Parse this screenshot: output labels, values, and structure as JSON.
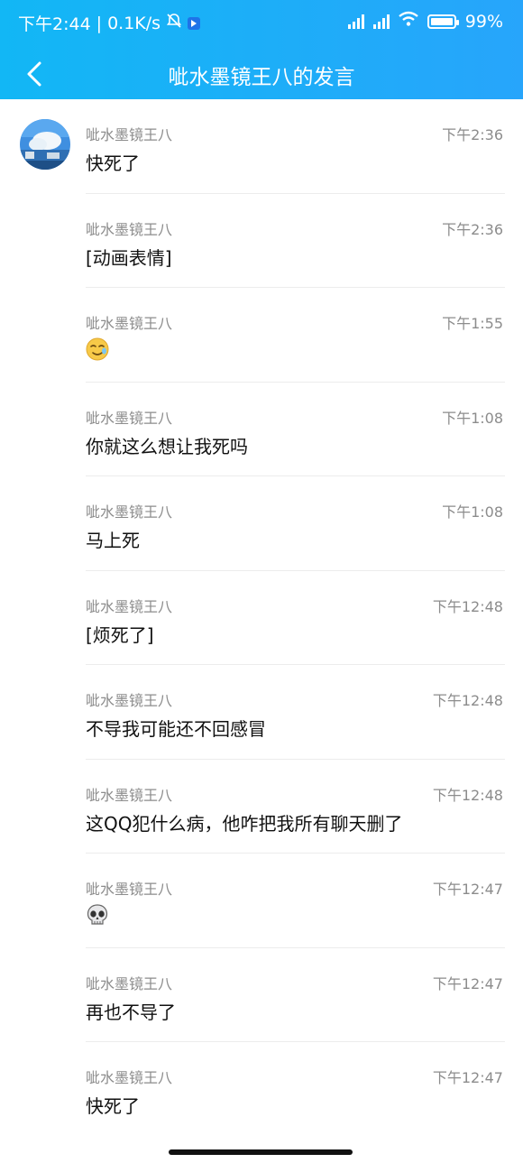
{
  "status_bar": {
    "time": "下午2:44",
    "separator": "|",
    "net_speed": "0.1K/s",
    "battery": "99%",
    "icons": [
      "mute-bell-icon",
      "app-notification-icon",
      "signal-icon",
      "signal-icon",
      "wifi-icon",
      "battery-icon"
    ]
  },
  "header": {
    "back_icon": "chevron-left-icon",
    "title": "呲水墨镜王八的发言"
  },
  "messages": [
    {
      "sender": "呲水墨镜王八",
      "time": "下午2:36",
      "text": "快死了"
    },
    {
      "sender": "呲水墨镜王八",
      "time": "下午2:36",
      "text": "[动画表情]"
    },
    {
      "sender": "呲水墨镜王八",
      "time": "下午1:55",
      "text": "",
      "emoji": "sweat-smile-emoji-icon"
    },
    {
      "sender": "呲水墨镜王八",
      "time": "下午1:08",
      "text": "你就这么想让我死吗"
    },
    {
      "sender": "呲水墨镜王八",
      "time": "下午1:08",
      "text": "马上死"
    },
    {
      "sender": "呲水墨镜王八",
      "time": "下午12:48",
      "text": "[烦死了]"
    },
    {
      "sender": "呲水墨镜王八",
      "time": "下午12:48",
      "text": "不导我可能还不回感冒"
    },
    {
      "sender": "呲水墨镜王八",
      "time": "下午12:48",
      "text": "这QQ犯什么病，他咋把我所有聊天删了"
    },
    {
      "sender": "呲水墨镜王八",
      "time": "下午12:47",
      "text": "",
      "emoji": "skull-emoji-icon"
    },
    {
      "sender": "呲水墨镜王八",
      "time": "下午12:47",
      "text": "再也不导了"
    },
    {
      "sender": "呲水墨镜王八",
      "time": "下午12:47",
      "text": "快死了"
    }
  ],
  "colors": {
    "header_gradient_start": "#12b7f5",
    "header_gradient_end": "#27a5fb",
    "meta_text": "#8c8c8c",
    "divider": "#ececec"
  }
}
